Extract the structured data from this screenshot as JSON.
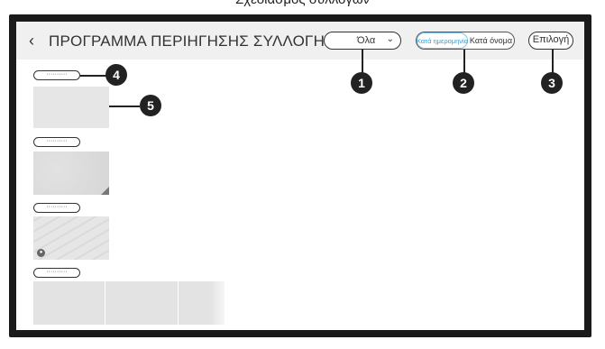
{
  "caption": "Σχεδιασμός συλλογών",
  "topbar": {
    "title": "ΠΡΟΓΡΑΜΜΑ ΠΕΡΙΗΓΗΣΗΣ ΣΥΛΛΟΓΗΣ",
    "filter_value": "Όλα",
    "sort_by_date_label": "Κατά ημερομηνία",
    "sort_by_name_label": "Κατά όνομα",
    "select_label": "Επιλογή"
  },
  "collections": [
    {
      "label": "··········"
    },
    {
      "label": "··········"
    },
    {
      "label": "··········"
    },
    {
      "label": "··········"
    }
  ],
  "callouts": [
    "1",
    "2",
    "3",
    "4",
    "5"
  ],
  "icons": {
    "back": "chevron-left-icon",
    "dropdown": "chevron-down-icon",
    "lock": "lock-icon"
  },
  "colors": {
    "accent": "#2d9fd8",
    "frame": "#1a1a1a",
    "topbar": "#f0f0f0"
  }
}
